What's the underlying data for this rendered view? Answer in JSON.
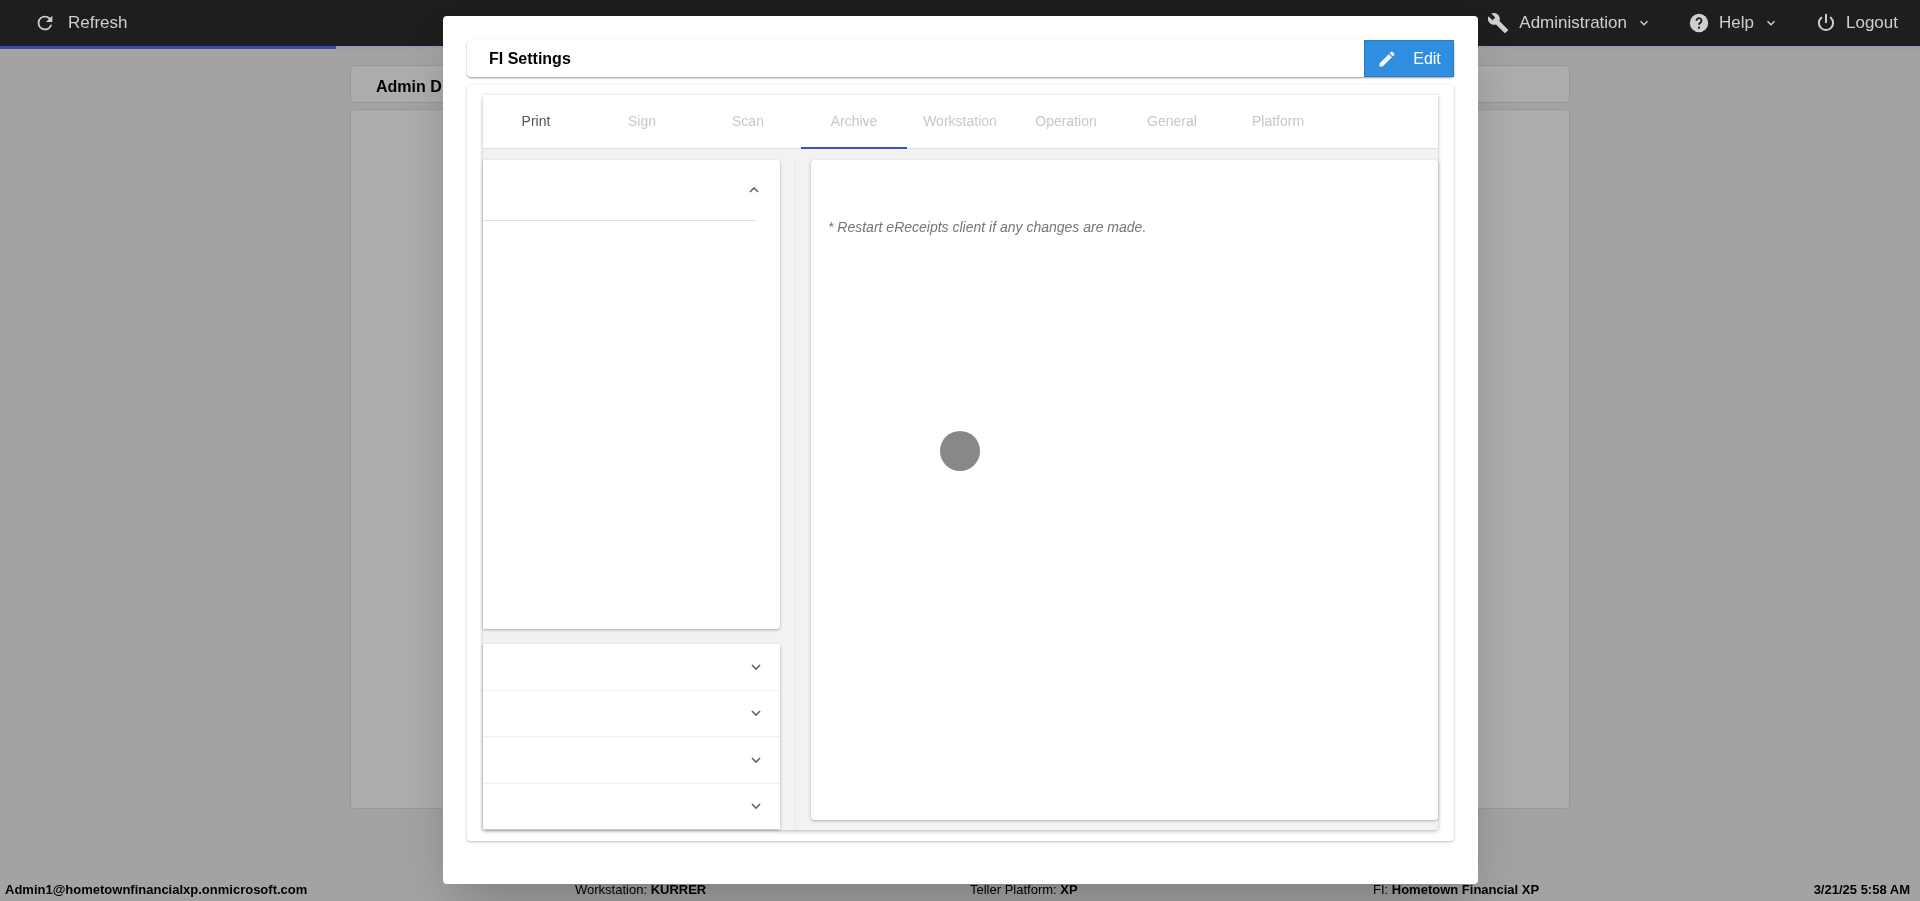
{
  "top_bar": {
    "refresh_label": "Refresh",
    "loading": {
      "level": 0.175
    },
    "menus": [
      {
        "kind": "wrench",
        "label": "Administration",
        "dropdown": true
      },
      {
        "kind": "help",
        "label": "Help",
        "dropdown": true
      },
      {
        "kind": "power",
        "label": "Logout",
        "dropdown": false
      }
    ]
  },
  "background": {
    "card_title": "Admin D"
  },
  "modal": {
    "title": "FI Settings",
    "edit_button": "Edit",
    "loading": true,
    "tabs": [
      {
        "label": "Print",
        "selected": false,
        "disabled": false
      },
      {
        "label": "Sign",
        "selected": false,
        "disabled": true
      },
      {
        "label": "Scan",
        "selected": false,
        "disabled": true
      },
      {
        "label": "Archive",
        "selected": true,
        "disabled": true
      },
      {
        "label": "Workstation",
        "selected": false,
        "disabled": true
      },
      {
        "label": "Operation",
        "selected": false,
        "disabled": true
      },
      {
        "label": "General",
        "selected": false,
        "disabled": true
      },
      {
        "label": "Platform",
        "selected": false,
        "disabled": true
      }
    ],
    "panels": [
      {
        "expanded": true
      }
    ],
    "accordion": [
      {
        "expanded": false
      },
      {
        "expanded": false
      },
      {
        "expanded": false
      },
      {
        "expanded": false
      }
    ],
    "note": "* Restart eReceipts client if any changes are made."
  },
  "status_bar": [
    {
      "label": "Admin1@hometownfinancialxp.onmicrosoft.com"
    },
    {
      "label": "Workstation:",
      "value": "KURRER"
    },
    {
      "label": "Teller Platform:",
      "value": "XP"
    },
    {
      "label": "FI:",
      "value": "Hometown Financial XP"
    },
    {
      "label": "3/21/25 5:58 AM"
    }
  ]
}
